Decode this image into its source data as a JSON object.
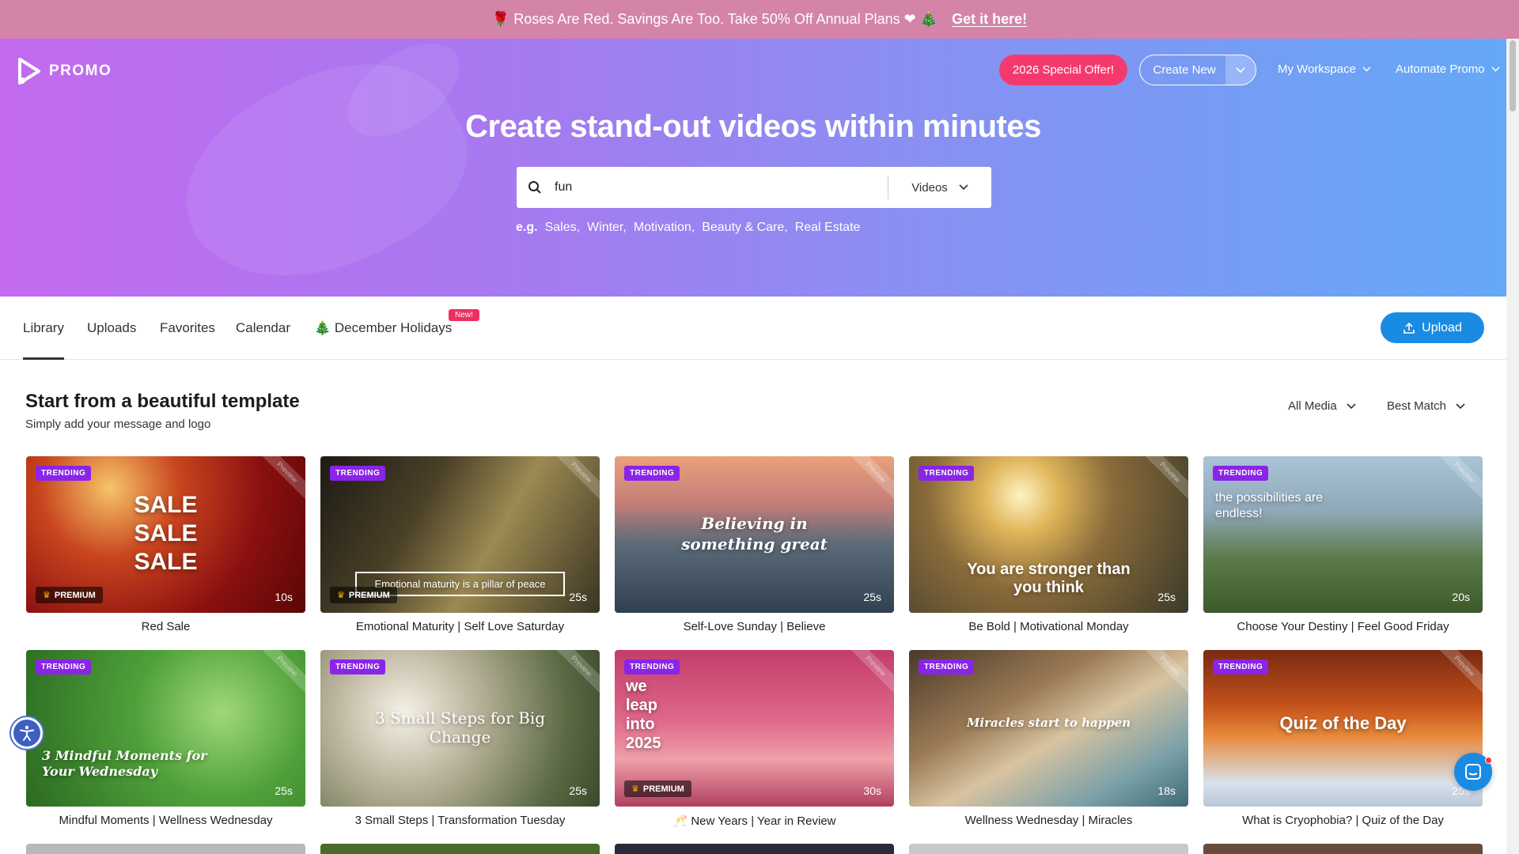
{
  "announcement": {
    "text": "🌹 Roses Are Red. Savings Are Too. Take 50% Off Annual Plans ❤ 🎄",
    "link": "Get it here!"
  },
  "header": {
    "logo_text": "PROMO",
    "special_offer": "2026 Special Offer!",
    "create_new": "Create New",
    "my_workspace": "My Workspace",
    "automate_promo": "Automate Promo"
  },
  "hero": {
    "title": "Create stand-out videos within minutes",
    "search_value": "fun",
    "search_type": "Videos",
    "eg_label": "e.g.",
    "suggestions": [
      "Sales,",
      "Winter,",
      "Motivation,",
      "Beauty & Care,",
      "Real Estate"
    ]
  },
  "tabs": {
    "items": [
      "Library",
      "Uploads",
      "Favorites",
      "Calendar",
      "🎄 December Holidays"
    ],
    "new_badge": "New!",
    "upload": "Upload"
  },
  "section": {
    "title": "Start from a beautiful template",
    "subtitle": "Simply add your message and logo",
    "filter_media": "All Media",
    "filter_sort": "Best Match"
  },
  "labels": {
    "trending": "TRENDING",
    "premium": "PREMIUM",
    "preview": "Preview"
  },
  "cards": [
    {
      "title": "Red Sale",
      "duration": "10s",
      "overlay": "SALE\nSALE\nSALE",
      "premium": true
    },
    {
      "title": "Emotional Maturity | Self Love Saturday",
      "duration": "25s",
      "overlay": "Emotional maturity is a pillar of peace",
      "premium": true
    },
    {
      "title": "Self-Love Sunday | Believe",
      "duration": "25s",
      "overlay": "Believing in something great",
      "premium": false
    },
    {
      "title": "Be Bold | Motivational Monday",
      "duration": "25s",
      "overlay": "You are stronger than you think",
      "premium": false
    },
    {
      "title": "Choose Your Destiny | Feel Good Friday",
      "duration": "20s",
      "overlay": "the possibilities are endless!",
      "premium": false
    },
    {
      "title": "Mindful Moments | Wellness Wednesday",
      "duration": "25s",
      "overlay": "3 Mindful Moments for Your Wednesday",
      "premium": false
    },
    {
      "title": "3 Small Steps | Transformation Tuesday",
      "duration": "25s",
      "overlay": "3 Small Steps for Big Change",
      "premium": false
    },
    {
      "title": "🥂 New Years | Year in Review",
      "duration": "30s",
      "overlay": "we leap into 2025",
      "premium": true
    },
    {
      "title": "Wellness Wednesday | Miracles",
      "duration": "18s",
      "overlay": "Miracles start to happen",
      "premium": false
    },
    {
      "title": "What is Cryophobia? | Quiz of the Day",
      "duration": "25s",
      "overlay": "Quiz of the Day",
      "premium": false
    }
  ],
  "colors": {
    "announcement_bg": "#d384a8",
    "special_offer_bg": "#f43a6d",
    "upload_bg": "#1a8be3",
    "trending_badge": "#8a24e8"
  }
}
